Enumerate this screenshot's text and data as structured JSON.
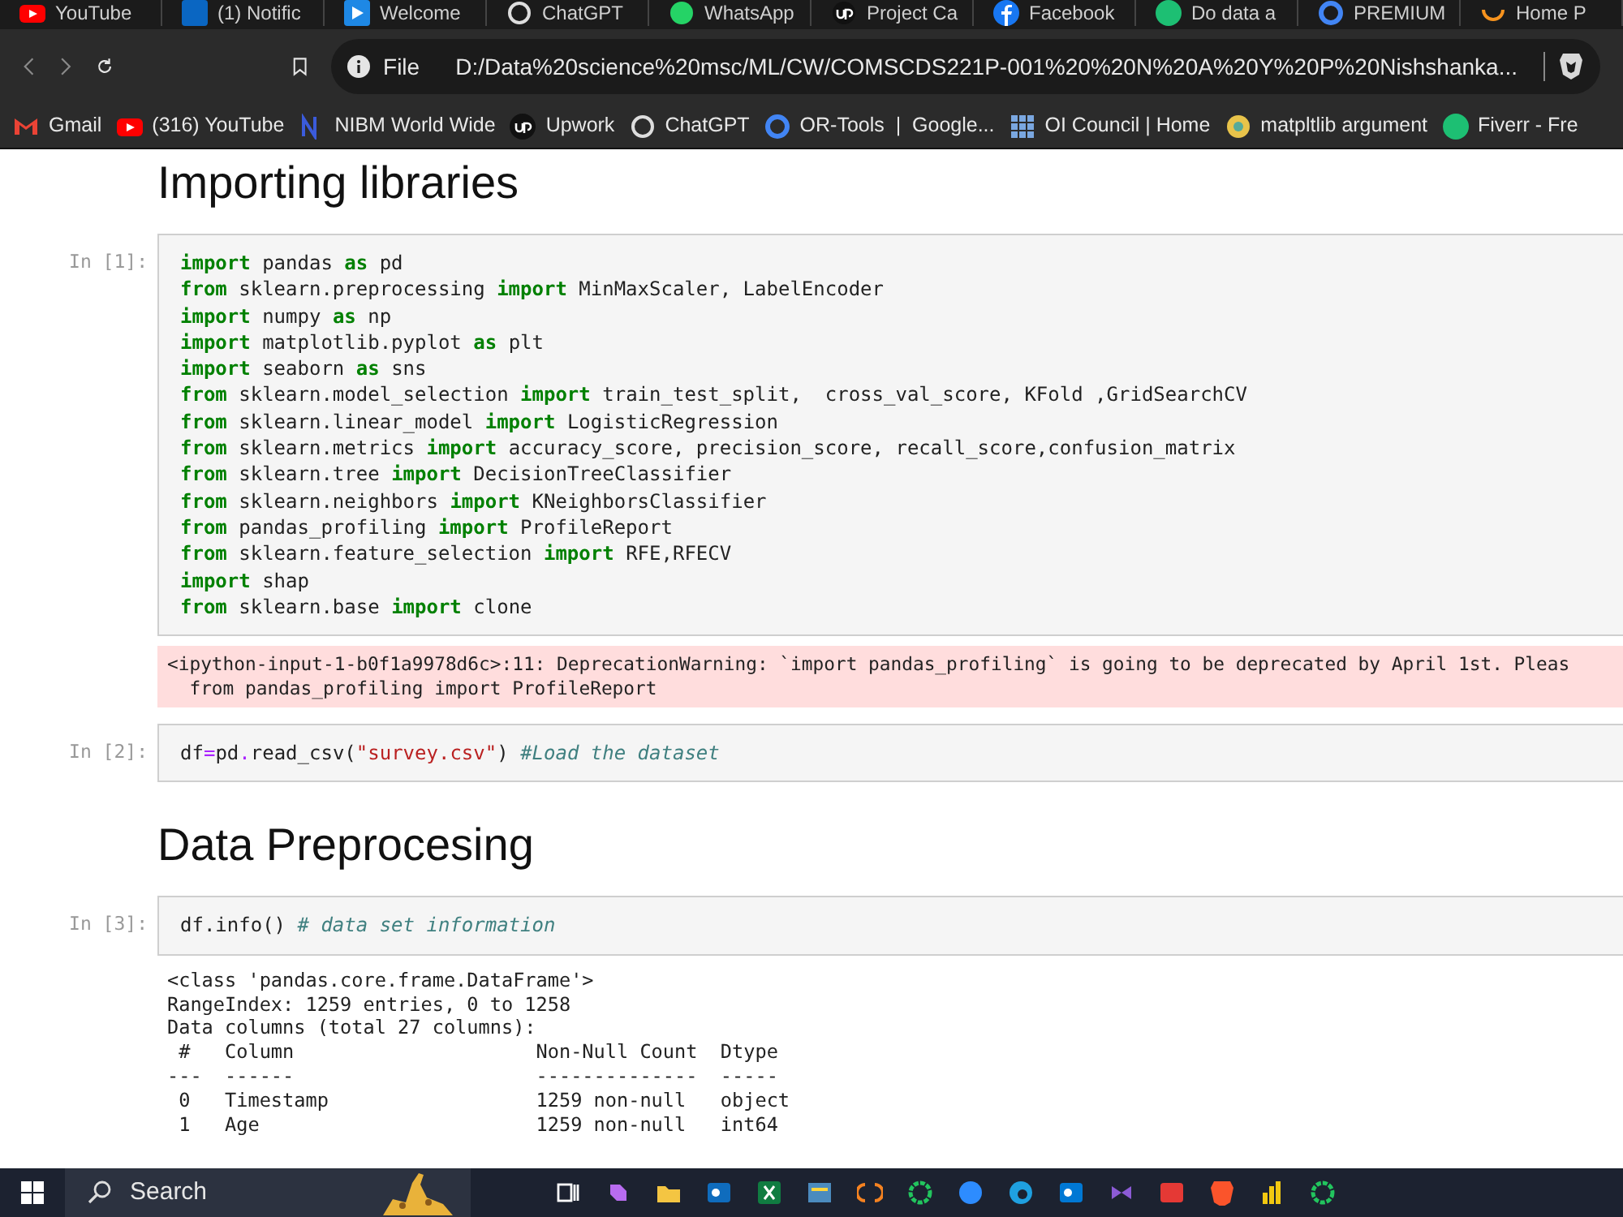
{
  "browser": {
    "tabs": [
      {
        "title": "YouTube"
      },
      {
        "title": "(1) Notific"
      },
      {
        "title": "Welcome"
      },
      {
        "title": "ChatGPT"
      },
      {
        "title": "WhatsApp"
      },
      {
        "title": "Project Ca"
      },
      {
        "title": "Facebook"
      },
      {
        "title": "Do data a"
      },
      {
        "title": "PREMIUM"
      },
      {
        "title": "Home P"
      }
    ],
    "address": {
      "scheme": "File",
      "url": "D:/Data%20science%20msc/ML/CW/COMSCDS221P-001%20%20N%20A%20Y%20P%20Nishshanka..."
    },
    "bookmarks": [
      {
        "label": "Gmail"
      },
      {
        "label": "(316) YouTube"
      },
      {
        "label": "NIBM World Wide"
      },
      {
        "label": "Upwork"
      },
      {
        "label": "ChatGPT"
      },
      {
        "label": "OR-Tools  |  Google..."
      },
      {
        "label": "OI Council | Home"
      },
      {
        "label": "matpltlib argument"
      },
      {
        "label": "Fiverr - Fre"
      }
    ]
  },
  "notebook": [
    {
      "kind": "heading",
      "text": "Importing libraries"
    },
    {
      "kind": "code",
      "prompt": "In [1]:",
      "lines": [
        [
          {
            "kind": "kw",
            "text": "import"
          },
          {
            "kind": "txt",
            "text": " pandas "
          },
          {
            "kind": "kw",
            "text": "as"
          },
          {
            "kind": "txt",
            "text": " pd"
          }
        ],
        [
          {
            "kind": "kw",
            "text": "from"
          },
          {
            "kind": "txt",
            "text": " sklearn.preprocessing "
          },
          {
            "kind": "kw",
            "text": "import"
          },
          {
            "kind": "txt",
            "text": " MinMaxScaler, LabelEncoder"
          }
        ],
        [
          {
            "kind": "kw",
            "text": "import"
          },
          {
            "kind": "txt",
            "text": " numpy "
          },
          {
            "kind": "kw",
            "text": "as"
          },
          {
            "kind": "txt",
            "text": " np"
          }
        ],
        [
          {
            "kind": "kw",
            "text": "import"
          },
          {
            "kind": "txt",
            "text": " matplotlib.pyplot "
          },
          {
            "kind": "kw",
            "text": "as"
          },
          {
            "kind": "txt",
            "text": " plt"
          }
        ],
        [
          {
            "kind": "kw",
            "text": "import"
          },
          {
            "kind": "txt",
            "text": " seaborn "
          },
          {
            "kind": "kw",
            "text": "as"
          },
          {
            "kind": "txt",
            "text": " sns"
          }
        ],
        [
          {
            "kind": "kw",
            "text": "from"
          },
          {
            "kind": "txt",
            "text": " sklearn.model_selection "
          },
          {
            "kind": "kw",
            "text": "import"
          },
          {
            "kind": "txt",
            "text": " train_test_split,  cross_val_score, KFold ,GridSearchCV"
          }
        ],
        [
          {
            "kind": "kw",
            "text": "from"
          },
          {
            "kind": "txt",
            "text": " sklearn.linear_model "
          },
          {
            "kind": "kw",
            "text": "import"
          },
          {
            "kind": "txt",
            "text": " LogisticRegression"
          }
        ],
        [
          {
            "kind": "kw",
            "text": "from"
          },
          {
            "kind": "txt",
            "text": " sklearn.metrics "
          },
          {
            "kind": "kw",
            "text": "import"
          },
          {
            "kind": "txt",
            "text": " accuracy_score, precision_score, recall_score,confusion_matrix"
          }
        ],
        [
          {
            "kind": "kw",
            "text": "from"
          },
          {
            "kind": "txt",
            "text": " sklearn.tree "
          },
          {
            "kind": "kw",
            "text": "import"
          },
          {
            "kind": "txt",
            "text": " DecisionTreeClassifier"
          }
        ],
        [
          {
            "kind": "kw",
            "text": "from"
          },
          {
            "kind": "txt",
            "text": " sklearn.neighbors "
          },
          {
            "kind": "kw",
            "text": "import"
          },
          {
            "kind": "txt",
            "text": " KNeighborsClassifier"
          }
        ],
        [
          {
            "kind": "kw",
            "text": "from"
          },
          {
            "kind": "txt",
            "text": " pandas_profiling "
          },
          {
            "kind": "kw",
            "text": "import"
          },
          {
            "kind": "txt",
            "text": " ProfileReport"
          }
        ],
        [
          {
            "kind": "kw",
            "text": "from"
          },
          {
            "kind": "txt",
            "text": " sklearn.feature_selection "
          },
          {
            "kind": "kw",
            "text": "import"
          },
          {
            "kind": "txt",
            "text": " RFE,RFECV"
          }
        ],
        [
          {
            "kind": "kw",
            "text": "import"
          },
          {
            "kind": "txt",
            "text": " shap"
          }
        ],
        [
          {
            "kind": "kw",
            "text": "from"
          },
          {
            "kind": "txt",
            "text": " sklearn.base "
          },
          {
            "kind": "kw",
            "text": "import"
          },
          {
            "kind": "txt",
            "text": " clone"
          }
        ]
      ]
    },
    {
      "kind": "stderr",
      "lines": [
        "<ipython-input-1-b0f1a9978d6c>:11: DeprecationWarning: `import pandas_profiling` is going to be deprecated by April 1st. Pleas",
        "  from pandas_profiling import ProfileReport"
      ]
    },
    {
      "kind": "code",
      "prompt": "In [2]:",
      "lines": [
        [
          {
            "kind": "txt",
            "text": "df"
          },
          {
            "kind": "op",
            "text": "="
          },
          {
            "kind": "txt",
            "text": "pd"
          },
          {
            "kind": "op",
            "text": "."
          },
          {
            "kind": "txt",
            "text": "read_csv("
          },
          {
            "kind": "str",
            "text": "\"survey.csv\""
          },
          {
            "kind": "txt",
            "text": ") "
          },
          {
            "kind": "com",
            "text": "#Load the dataset"
          }
        ]
      ]
    },
    {
      "kind": "heading",
      "text": "Data Preprocesing"
    },
    {
      "kind": "code",
      "prompt": "In [3]:",
      "lines": [
        [
          {
            "kind": "txt",
            "text": "df.info() "
          },
          {
            "kind": "com",
            "text": "# data set information"
          }
        ]
      ]
    },
    {
      "kind": "stdout",
      "lines": [
        "<class 'pandas.core.frame.DataFrame'>",
        "RangeIndex: 1259 entries, 0 to 1258",
        "Data columns (total 27 columns):",
        " #   Column                     Non-Null Count  Dtype",
        "---  ------                     --------------  -----",
        " 0   Timestamp                  1259 non-null   object",
        " 1   Age                        1259 non-null   int64"
      ]
    }
  ],
  "taskbar": {
    "search": {
      "placeholder": "Search"
    }
  }
}
